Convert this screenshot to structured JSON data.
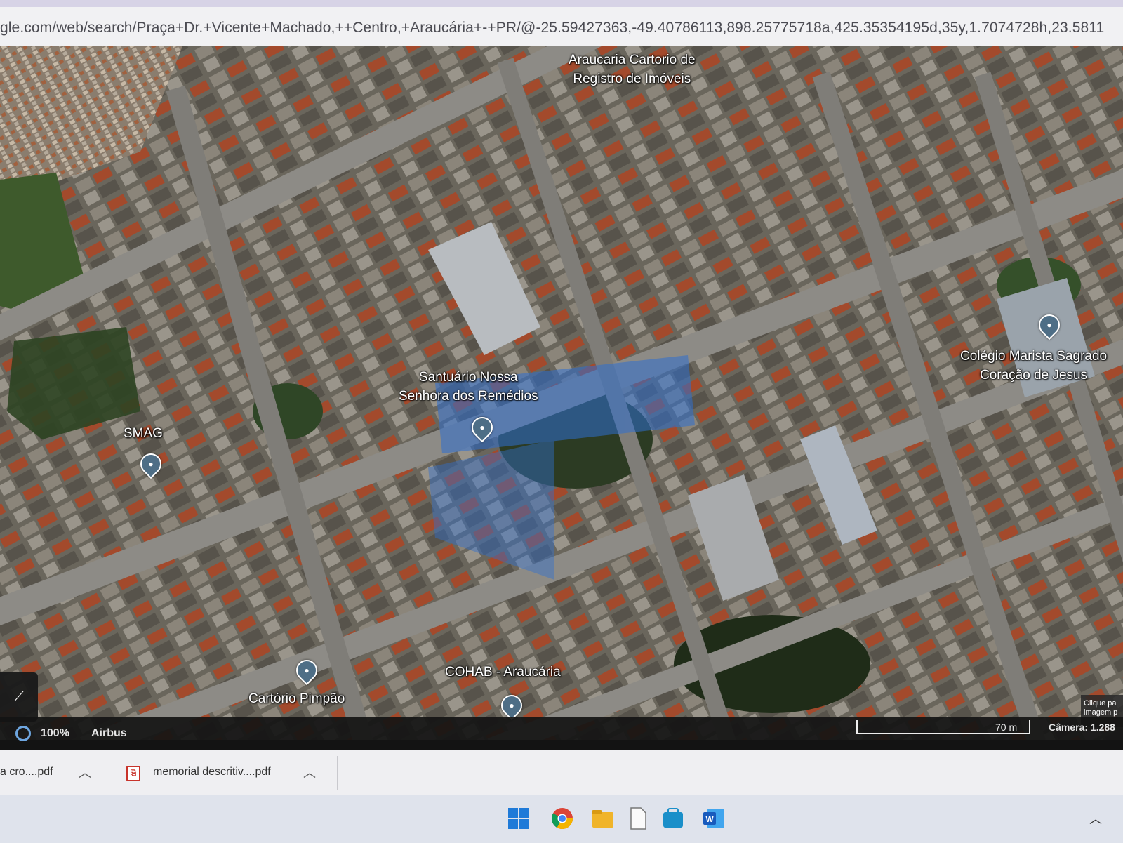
{
  "browser": {
    "url": "gle.com/web/search/Praça+Dr.+Vicente+Machado,++Centro,+Araucária+-+PR/@-25.59427363,-49.40786113,898.25775718a,425.35354195d,35y,1.7074728h,23.5811"
  },
  "map": {
    "labels": {
      "registro_line1": "Araucaria Cartorio de",
      "registro_line2": "Registro de Imóveis",
      "santuario_line1": "Santuário Nossa",
      "santuario_line2": "Senhora dos Remédios",
      "smag": "SMAG",
      "colegio_line1": "Colégio Marista Sagrado",
      "colegio_line2": "Coração de Jesus",
      "cohab": "COHAB - Araucária",
      "pimpao": "Cartório Pimpão"
    },
    "help_text_line1": "Clique pa",
    "help_text_line2": "imagem p"
  },
  "status_bar": {
    "zoom": "100%",
    "imagery": "Airbus",
    "scale": "70 m",
    "camera": "Câmera: 1.288"
  },
  "downloads": [
    {
      "name": "a cro....pdf"
    },
    {
      "name": "memorial descritiv....pdf"
    }
  ],
  "colors": {
    "pin": "#4e6e86",
    "watermark": "#2f6fd0",
    "taskbar": "#dfe3ec"
  },
  "icons": {
    "windows": "windows-start-icon",
    "chrome": "chrome-icon",
    "explorer": "file-explorer-icon",
    "file": "file-icon",
    "store": "store-icon",
    "word": "word-icon"
  }
}
